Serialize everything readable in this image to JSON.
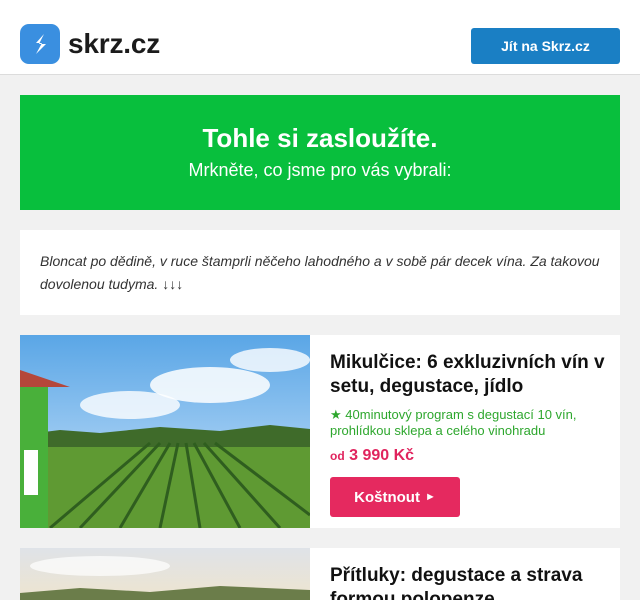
{
  "header": {
    "logo_text": "skrz.cz",
    "cta_label": "Jít na Skrz.cz",
    "brand_color": "#3a8fe0",
    "button_color": "#1a7fc4"
  },
  "hero": {
    "title": "Tohle si zasloužíte.",
    "subtitle": "Mrkněte, co jsme pro vás vybrali:",
    "background": "#08bf3d"
  },
  "intro": {
    "text": "Bloncat po dědině, v ruce štamprli něčeho lahodného a v sobě pár decek vína. Za takovou dovolenou tudyma. ↓↓↓"
  },
  "deals": [
    {
      "title": "Mikulčice: 6 exkluzivních vín v setu, degustace, jídlo",
      "description": "40minutový program s degustací 10 vín, prohlídkou sklepa a celého vinohradu",
      "price_prefix": "od",
      "price": "3 990 Kč",
      "button_label": "Koštnout",
      "image": "vineyard with green house"
    },
    {
      "title": "Přítluky: degustace a strava formou polopenze",
      "image": "vineyard under evening sky"
    }
  ],
  "icons": {
    "star": "★",
    "arrow": "►"
  },
  "colors": {
    "accent": "#e5295f",
    "desc_green": "#2ea72e"
  }
}
